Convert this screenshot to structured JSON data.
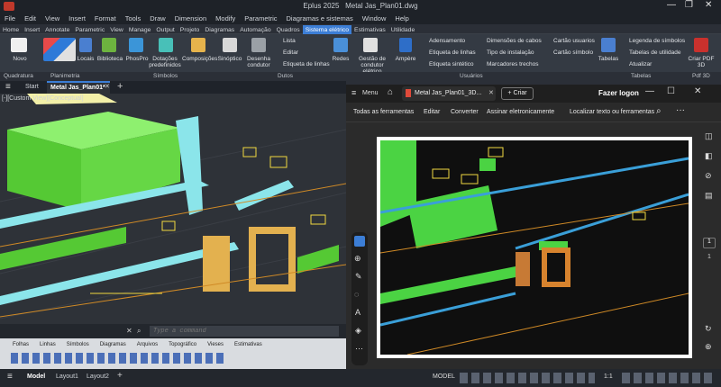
{
  "app": {
    "title": "Eplus 2025",
    "file": "Metal Jas_Plan01.dwg"
  },
  "menu": [
    "File",
    "Edit",
    "View",
    "Insert",
    "Format",
    "Tools",
    "Draw",
    "Dimension",
    "Modify",
    "Parametric",
    "Diagramas e sistemas",
    "Window",
    "Help"
  ],
  "ribbon_tabs": [
    "Home",
    "Insert",
    "Annotate",
    "Parametric",
    "View",
    "Manage",
    "Output",
    "Projeto",
    "Diagramas",
    "Automação",
    "Quadros",
    "Sistema elétrico",
    "Estimativas",
    "Utilidade"
  ],
  "ribbon_active_tab": "Sistema elétrico",
  "ribbon": {
    "novo": "Novo",
    "locais": "Locais",
    "biblioteca": "Biblioteca",
    "phospro": "PhosPro",
    "dotacoes": "Dotações predefinidos",
    "composicoes": "Composições",
    "sinoptico": "Sinóptico",
    "desenha": "Desenha condutor",
    "lista": "Lista",
    "editar": "Editar",
    "etiqueta": "Etiqueta de linhas",
    "redes": "Redes",
    "gestao": "Gestão de condutor elétrico",
    "ampere": "Ampère",
    "adensamento": "Adensamento",
    "etiqueta_linhas": "Etiqueta de linhas",
    "etiqueta_sintetico": "Etiqueta sintético",
    "dimensoes": "Dimensões de cabos",
    "tipo_instalacao": "Tipo de instalação",
    "marcadores": "Marcadores trechos",
    "cartao_usuarios": "Cartão usuarios",
    "cartao_simbolo": "Cartão símbolo",
    "tabelas": "Tabelas",
    "legenda": "Legenda de símbolos",
    "tabelas_utilidade": "Tabelas de utilidade",
    "atualizar": "Atualizar",
    "criar_pdf": "Criar PDF 3D"
  },
  "groups": {
    "quadratura": "Quadratura",
    "planimetria": "Planimetria",
    "simbolos": "Símbolos",
    "dutos": "Dutos",
    "usuarios": "Usuários",
    "tabelas": "Tabelas",
    "pdf": "Pdf 3D"
  },
  "doc_tabs": {
    "start": "Start",
    "file": "Metal Jas_Plan01*"
  },
  "viewport": {
    "label": "[-][Custom View][Conceptual]"
  },
  "command": {
    "placeholder": "Type a command"
  },
  "palette_tabs": [
    "Folhas",
    "Linhas",
    "Símbolos",
    "Diagramas",
    "Arquivos",
    "Topográfico",
    "Vieses",
    "Estimativas"
  ],
  "layouts": [
    "Model",
    "Layout1",
    "Layout2"
  ],
  "status": {
    "model": "MODEL",
    "scale": "1:1"
  },
  "pdf": {
    "menu": "Menu",
    "tab_title": "Metal Jas_Plan01_3D...",
    "create": "Criar",
    "logon": "Fazer logon",
    "tools": [
      "Todas as ferramentas",
      "Editar",
      "Converter",
      "Assinar eletronicamente"
    ],
    "find": "Localizar texto ou ferramentas",
    "page_num": "1",
    "page_total": "1"
  },
  "colors": {
    "accent": "#3c7ed6",
    "green": "#4bd343",
    "cyan": "#7ee0e6",
    "orange": "#e3b14f"
  }
}
